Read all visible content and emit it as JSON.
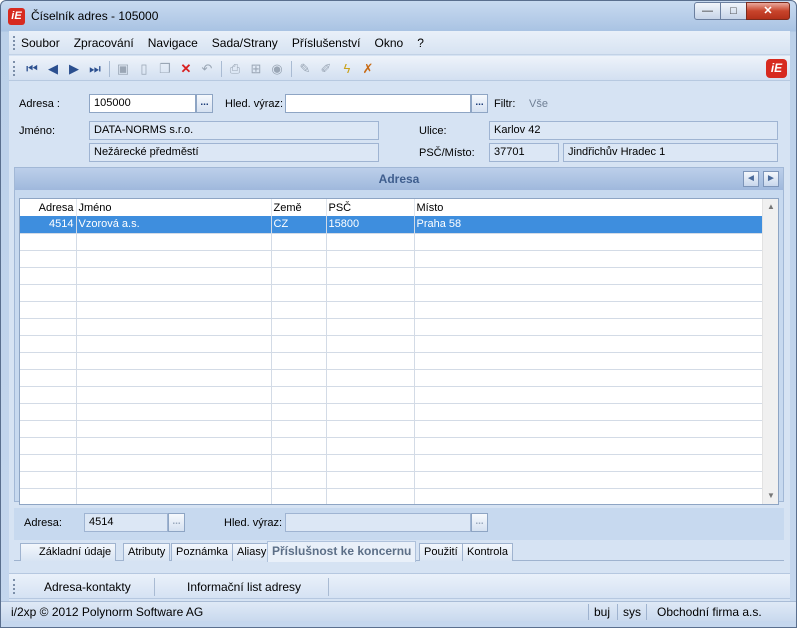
{
  "window": {
    "title": "Číselník adres - 105000",
    "logo_text": "iE",
    "buttons": {
      "minimize": "—",
      "maximize": "□",
      "close": "✕"
    }
  },
  "menu": [
    "Soubor",
    "Zpracování",
    "Navigace",
    "Sada/Strany",
    "Příslušenství",
    "Okno",
    "?"
  ],
  "toolbar": {
    "icons": [
      "first-record-icon",
      "previous-record-icon",
      "next-record-icon",
      "last-record-icon",
      "save-icon",
      "new-icon",
      "copy-icon",
      "delete-icon",
      "undo-icon",
      "print-icon",
      "tree-icon",
      "refresh-icon",
      "edit-icon",
      "edit-disabled-icon",
      "wizard-icon",
      "filter-clear-icon"
    ],
    "logo_text": "iE"
  },
  "form": {
    "adresa_label": "Adresa :",
    "adresa_value": "105000",
    "hled_label": "Hled. výraz:",
    "hled_value": "",
    "filtr_label": "Filtr:",
    "filtr_value": "Vše",
    "jmeno_label": "Jméno:",
    "jmeno_value": "DATA-NORMS s.r.o.",
    "jmeno2_value": "Nežárecké předměstí",
    "ulice_label": "Ulice:",
    "ulice_value": "Karlov 42",
    "psc_label": "PSČ/Místo:",
    "psc_value": "37701",
    "misto_value": "Jindřichův Hradec 1",
    "dots": "..."
  },
  "panel": {
    "title": "Adresa",
    "prev": "◄",
    "next": "►"
  },
  "grid": {
    "columns": [
      "Adresa",
      "Jméno",
      "Země",
      "PSČ",
      "Místo"
    ],
    "rows": [
      {
        "adresa": "4514",
        "jmeno": "Vzorová a.s.",
        "zeme": "CZ",
        "psc": "15800",
        "misto": "Praha 58"
      }
    ]
  },
  "bottom_form": {
    "adresa_label": "Adresa:",
    "adresa_value": "4514",
    "hled_label": "Hled. výraz:",
    "hled_value": "",
    "dots": "..."
  },
  "tabs": [
    "Základní údaje",
    "Atributy",
    "Poznámka",
    "Aliasy",
    "Příslušnost ke koncernu",
    "Použití",
    "Kontrola"
  ],
  "active_tab": "Příslušnost ke koncernu",
  "links": [
    "Adresa-kontakty",
    "Informační list adresy"
  ],
  "status": {
    "copyright": "i/2xp © 2012 Polynorm Software AG",
    "user": "buj",
    "db": "sys",
    "company": "Obchodní firma a.s."
  }
}
